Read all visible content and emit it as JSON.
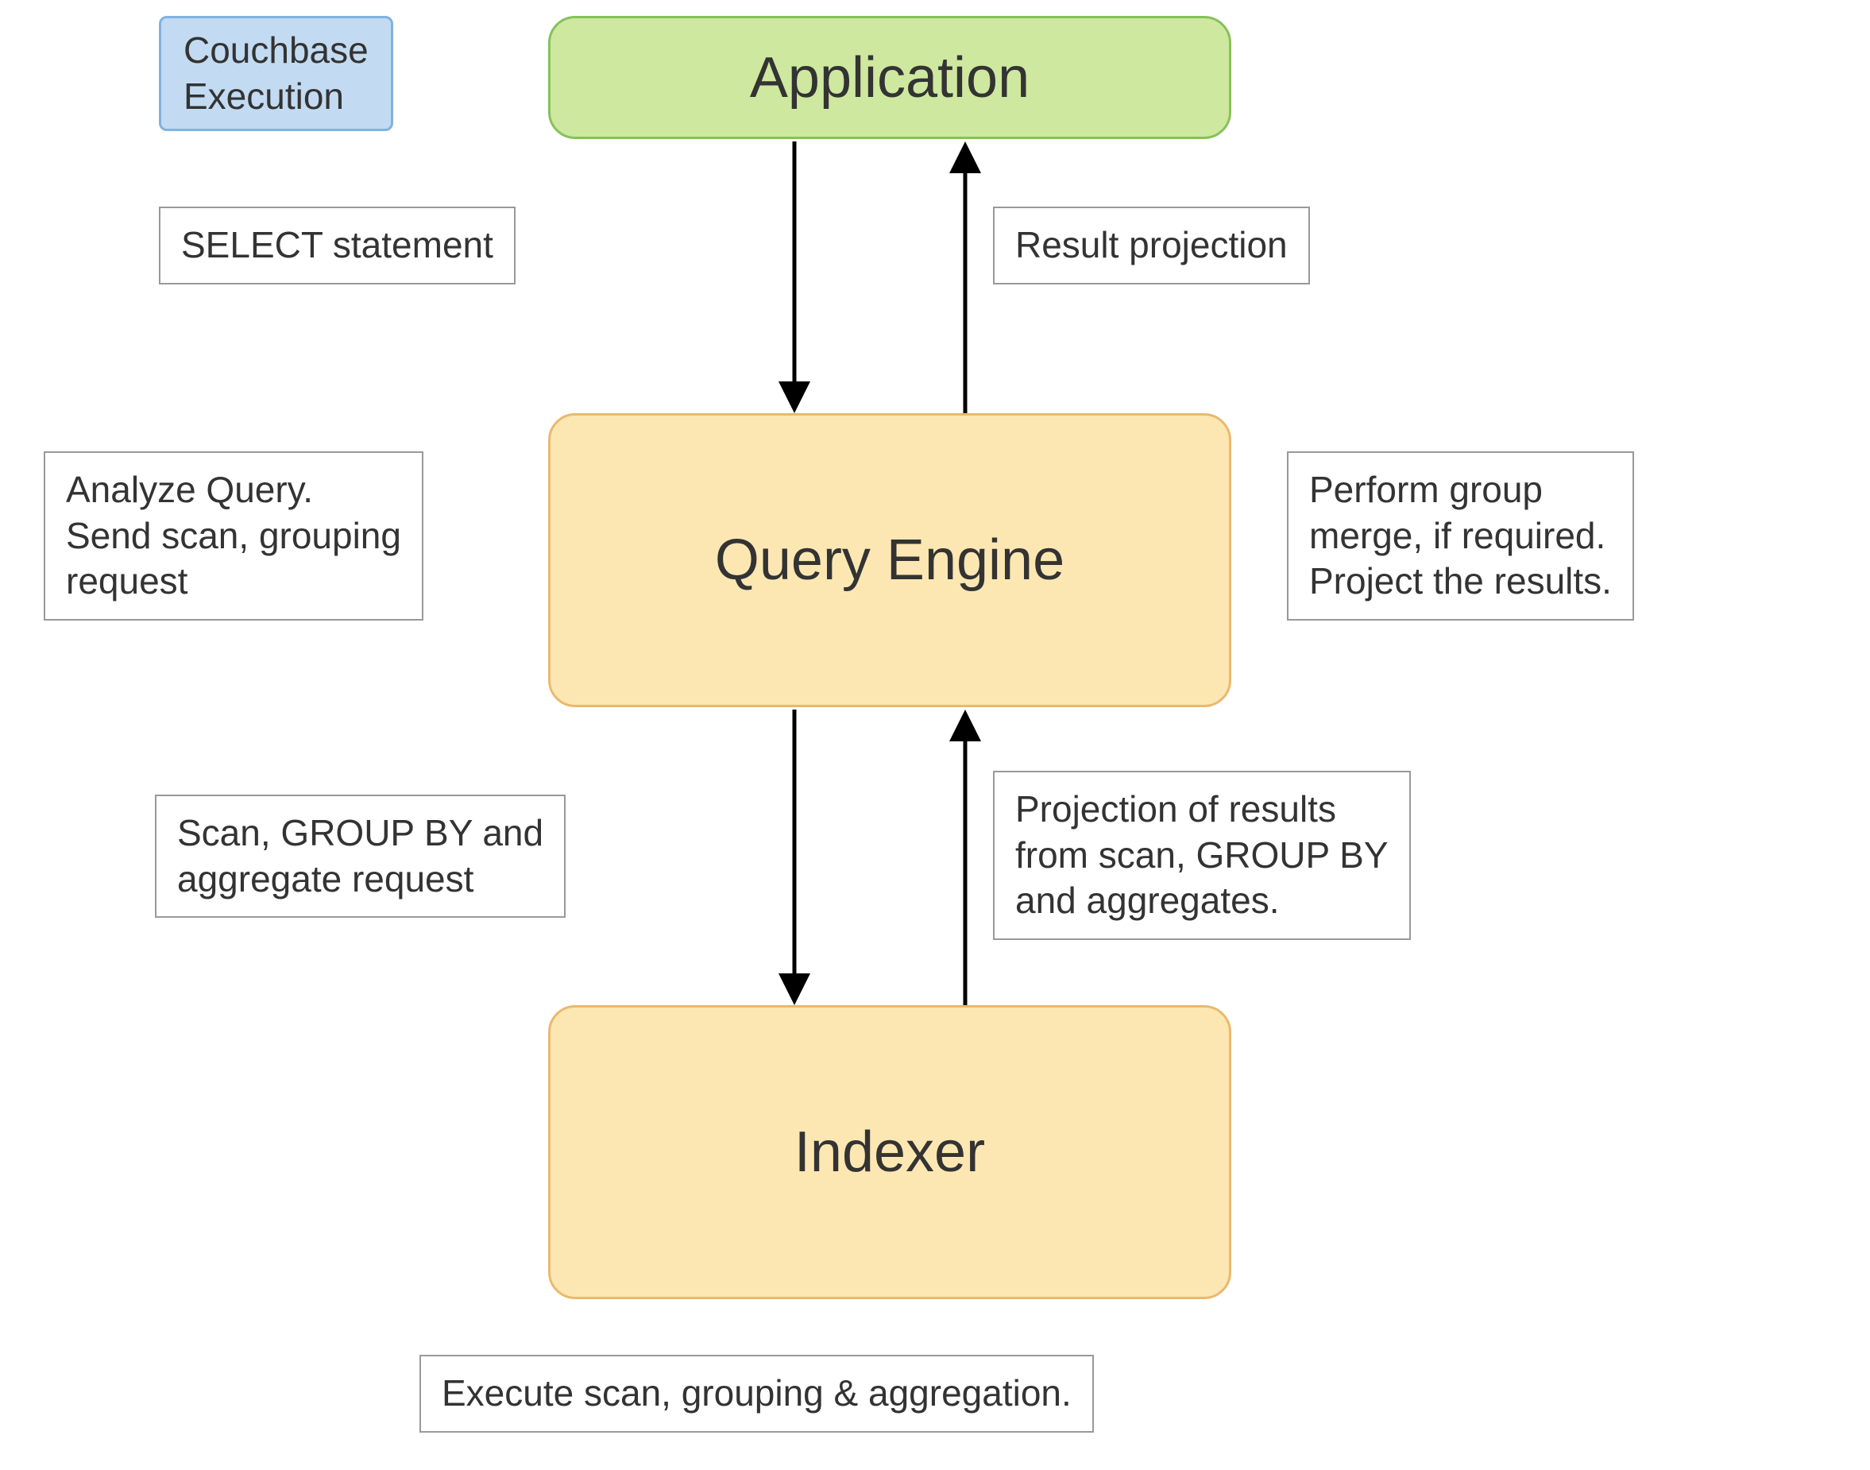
{
  "legend": {
    "label": "Couchbase\nExecution"
  },
  "nodes": {
    "application": {
      "label": "Application"
    },
    "query_engine": {
      "label": "Query Engine"
    },
    "indexer": {
      "label": "Indexer"
    }
  },
  "edges": {
    "app_to_engine_left": {
      "label": "SELECT statement"
    },
    "engine_to_app_right": {
      "label": "Result projection"
    },
    "engine_left_note": {
      "label": "Analyze Query.\nSend scan, grouping\nrequest"
    },
    "engine_right_note": {
      "label": "Perform group\nmerge, if required.\nProject the results."
    },
    "engine_to_indexer_left": {
      "label": "Scan, GROUP BY and\naggregate request"
    },
    "indexer_to_engine_right": {
      "label": "Projection of results\nfrom scan, GROUP BY\nand aggregates."
    },
    "indexer_bottom_note": {
      "label": "Execute scan, grouping & aggregation."
    }
  },
  "colors": {
    "node_green_bg": "#cee89f",
    "node_green_border": "#86c15b",
    "node_cream_bg": "#fce7b2",
    "node_cream_border": "#e9b96e",
    "legend_bg": "#c2dbf2",
    "legend_border": "#81b1de"
  }
}
